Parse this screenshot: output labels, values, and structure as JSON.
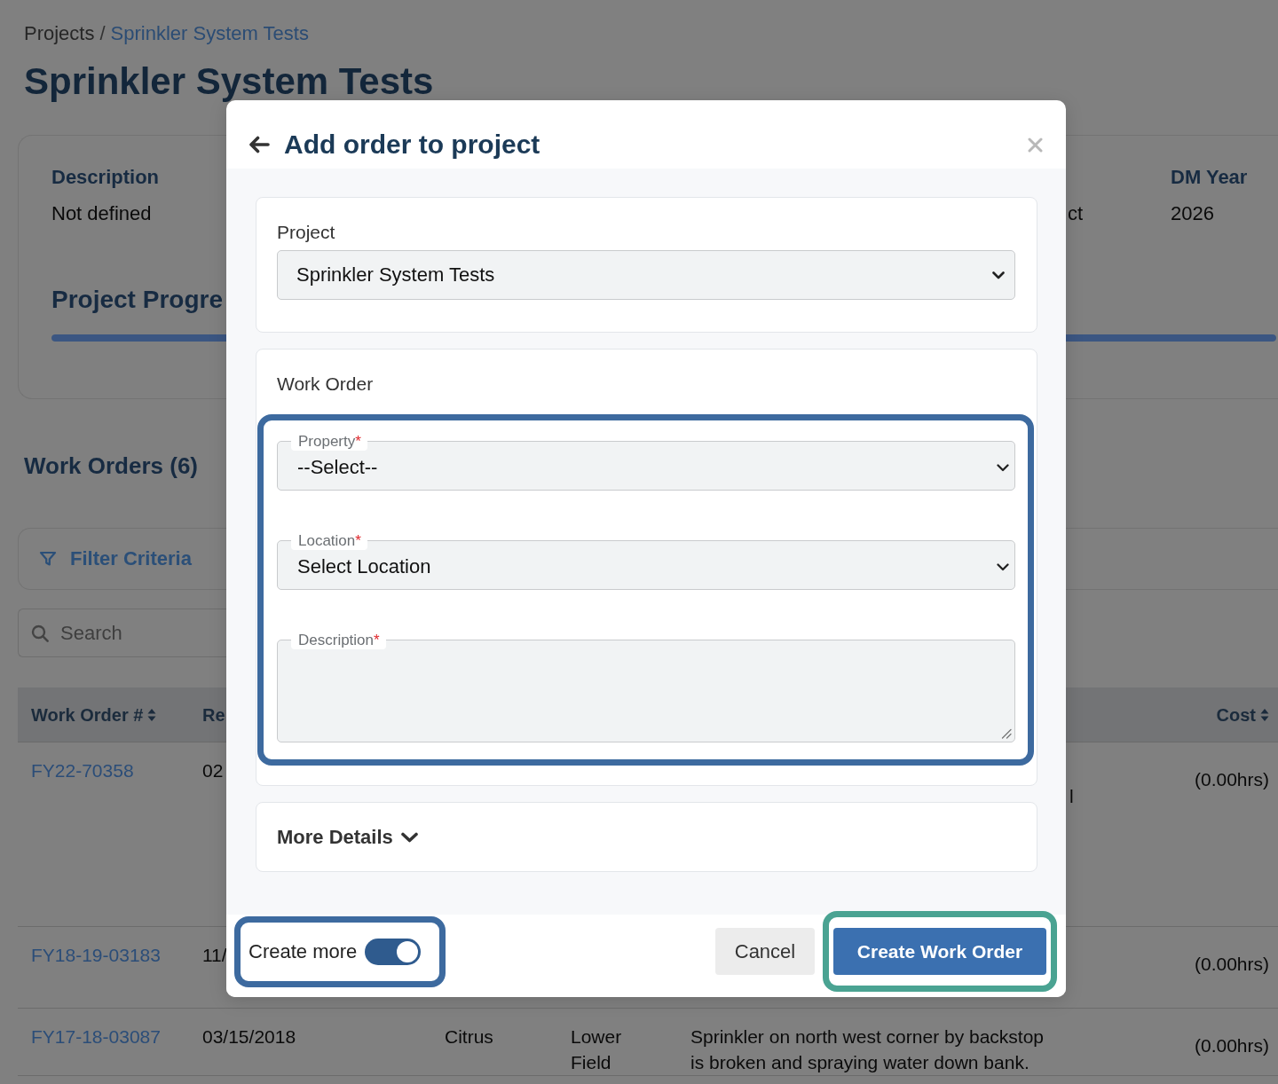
{
  "breadcrumb": {
    "items": [
      {
        "label": "Projects",
        "kind": "text"
      },
      {
        "label": "Sprinkler System Tests",
        "kind": "link"
      }
    ],
    "separator": "/"
  },
  "page_title": "Sprinkler System Tests",
  "summary": {
    "fields": [
      {
        "label": "Description",
        "value": "Not defined"
      },
      {
        "value": "ct"
      },
      {
        "label": "DM Year",
        "value": "2026"
      }
    ],
    "progress_title": "Project Progre",
    "progress": {
      "level": 1
    }
  },
  "work_orders": {
    "heading": "Work Orders (6)",
    "filter": {
      "label": "Filter Criteria"
    },
    "search": {
      "placeholder": "Search"
    },
    "table": {
      "columns": {
        "work_order": {
          "label": "Work Order #",
          "sortable": true
        },
        "date": {
          "label": "Re"
        },
        "cost": {
          "label": "Cost",
          "sortable": true
        }
      },
      "rows": [
        {
          "work_order": "FY22-70358",
          "date": "02",
          "column_6": "l",
          "cost": "(0.00hrs)"
        },
        {
          "work_order": "FY18-19-03183",
          "date": "11/",
          "cost": "(0.00hrs)"
        },
        {
          "work_order": "FY17-18-03087",
          "date": "03/15/2018",
          "column_3": "Citrus",
          "column_4": "Lower Field",
          "column_5": "Sprinkler on north west corner by backstop is broken and spraying water down bank.",
          "cost": "(0.00hrs)"
        }
      ]
    }
  },
  "modal": {
    "title": "Add order to project",
    "project_section": {
      "label": "Project",
      "select": {
        "value": "Sprinkler System Tests"
      }
    },
    "work_order_section": {
      "label": "Work Order",
      "highlighted": true,
      "fields": [
        {
          "kind": "select",
          "label": "Property",
          "required_mark": "*",
          "value": "--Select--"
        },
        {
          "kind": "select",
          "label": "Location",
          "required_mark": "*",
          "value": "Select Location"
        },
        {
          "kind": "textarea",
          "label": "Description",
          "required_mark": "*"
        }
      ]
    },
    "more_details": {
      "label": "More Details",
      "expanded": false
    },
    "create_more": {
      "label": "Create more",
      "on": true,
      "highlighted": true
    },
    "buttons": [
      {
        "label": "Cancel",
        "kind": "secondary"
      },
      {
        "label": "Create Work Order",
        "kind": "primary",
        "highlighted": true
      }
    ]
  }
}
